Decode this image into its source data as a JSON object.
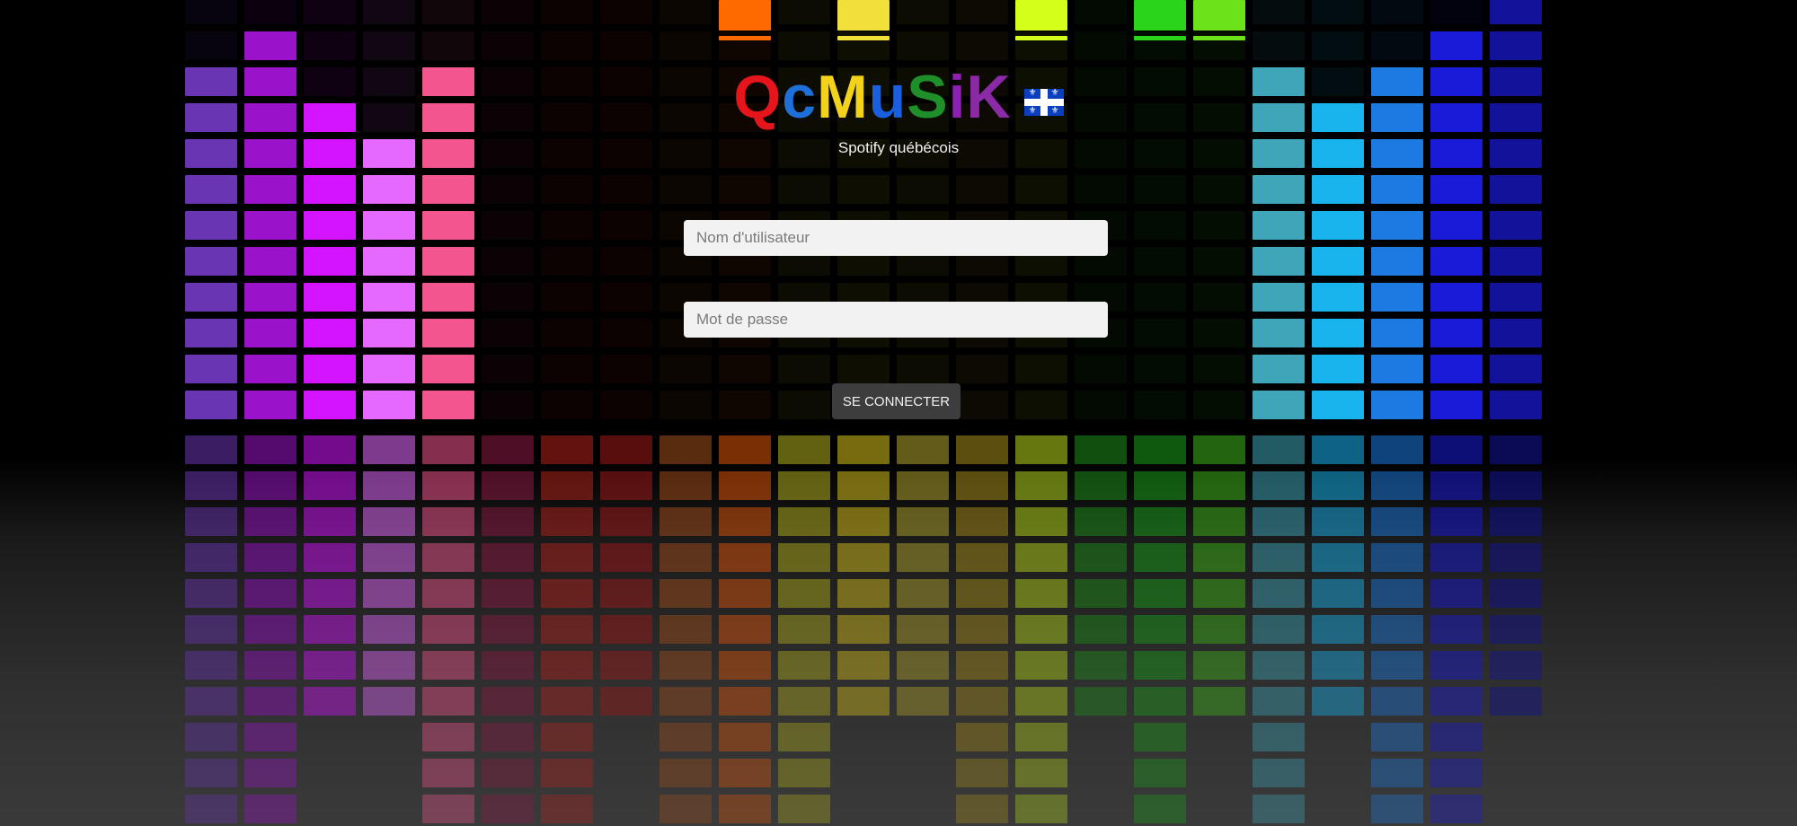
{
  "app": {
    "logo_letters": [
      {
        "char": "Q",
        "color": "#e6141b"
      },
      {
        "char": "c",
        "color": "#1e6fd9"
      },
      {
        "char": "M",
        "color": "#f2d21b"
      },
      {
        "char": "u",
        "color": "#1a5fe0"
      },
      {
        "char": "S",
        "color": "#1f8f2a"
      },
      {
        "char": "i",
        "color": "#8e1fb3"
      },
      {
        "char": "K",
        "color": "#8a2aa6"
      }
    ],
    "flag_icon": "quebec-flag-icon",
    "subtitle": "Spotify québécois"
  },
  "login": {
    "username_placeholder": "Nom d'utilisateur",
    "password_placeholder": "Mot de passe",
    "submit_label": "SE CONNECTER"
  },
  "equalizer": {
    "colors": [
      "#6a35b3",
      "#9a12c9",
      "#d414ff",
      "#e569ff",
      "#f3558e",
      "#8e1a45",
      "#b3231c",
      "#a31919",
      "#a34e1c",
      "#e0560a",
      "#b3b01c",
      "#d9c21c",
      "#b3a52e",
      "#a88e1a",
      "#b8d91a",
      "#1f8f1a",
      "#1aa31a",
      "#3fb81a",
      "#3fa5b8",
      "#19b3ee",
      "#1c7ae0",
      "#1a1ad9",
      "#12129a"
    ],
    "levels": [
      10,
      11,
      9,
      8,
      10,
      0,
      0,
      0,
      0,
      0,
      0,
      0,
      0,
      0,
      0,
      0,
      0,
      0,
      10,
      9,
      10,
      11,
      12
    ]
  }
}
